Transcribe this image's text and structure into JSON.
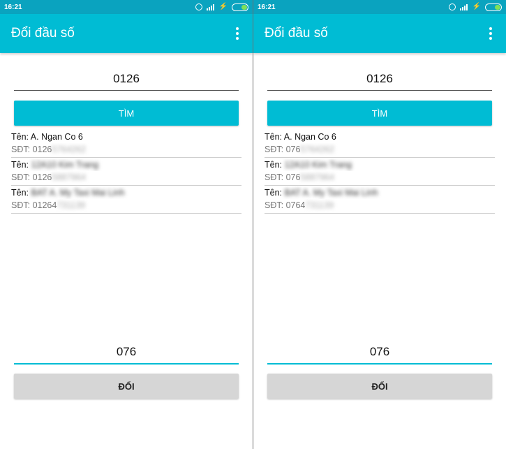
{
  "screens": [
    {
      "status": {
        "time": "16:21"
      },
      "app": {
        "title": "Đổi đầu số"
      },
      "prefix_input": {
        "value": "0126"
      },
      "search_button": {
        "label": "TÌM"
      },
      "results": [
        {
          "name_label": "Tên: ",
          "name_visible": "A. Ngan Co 6",
          "name_blurred": "",
          "phone_label": "SĐT: ",
          "phone_visible": "0126",
          "phone_blurred": "5764262"
        },
        {
          "name_label": "Tên: ",
          "name_visible": "",
          "name_blurred": "12A10 Kim Trang",
          "phone_label": "SĐT: ",
          "phone_visible": "0126",
          "phone_blurred": "5887964"
        },
        {
          "name_label": "Tên: ",
          "name_visible": "",
          "name_blurred": "BAT A. My Taxi Mai Linh",
          "phone_label": "SĐT: ",
          "phone_visible": "01264",
          "phone_blurred": "731139"
        }
      ],
      "new_prefix_input": {
        "value": "076"
      },
      "convert_button": {
        "label": "ĐỔI"
      }
    },
    {
      "status": {
        "time": "16:21"
      },
      "app": {
        "title": "Đổi đầu số"
      },
      "prefix_input": {
        "value": "0126"
      },
      "search_button": {
        "label": "TÌM"
      },
      "results": [
        {
          "name_label": "Tên: ",
          "name_visible": "A. Ngan Co 6",
          "name_blurred": "",
          "phone_label": "SĐT: ",
          "phone_visible": "076",
          "phone_blurred": "5764262"
        },
        {
          "name_label": "Tên: ",
          "name_visible": "",
          "name_blurred": "12A10 Kim Trang",
          "phone_label": "SĐT: ",
          "phone_visible": "076",
          "phone_blurred": "5887964"
        },
        {
          "name_label": "Tên: ",
          "name_visible": "",
          "name_blurred": "BAT A. My Taxi Mai Linh",
          "phone_label": "SĐT: ",
          "phone_visible": "0764",
          "phone_blurred": "731139"
        }
      ],
      "new_prefix_input": {
        "value": "076"
      },
      "convert_button": {
        "label": "ĐỔI"
      }
    }
  ],
  "colors": {
    "statusbar": "#0aa3bf",
    "appbar": "#00bcd4",
    "accent": "#00bcd4",
    "secondary_button": "#d6d6d6",
    "battery_fill": "#7ee05a"
  },
  "icons": {
    "status": [
      "alarm-icon",
      "signal-icon",
      "charging-bolt-icon",
      "battery-icon"
    ],
    "appbar": "more-vert-icon"
  }
}
